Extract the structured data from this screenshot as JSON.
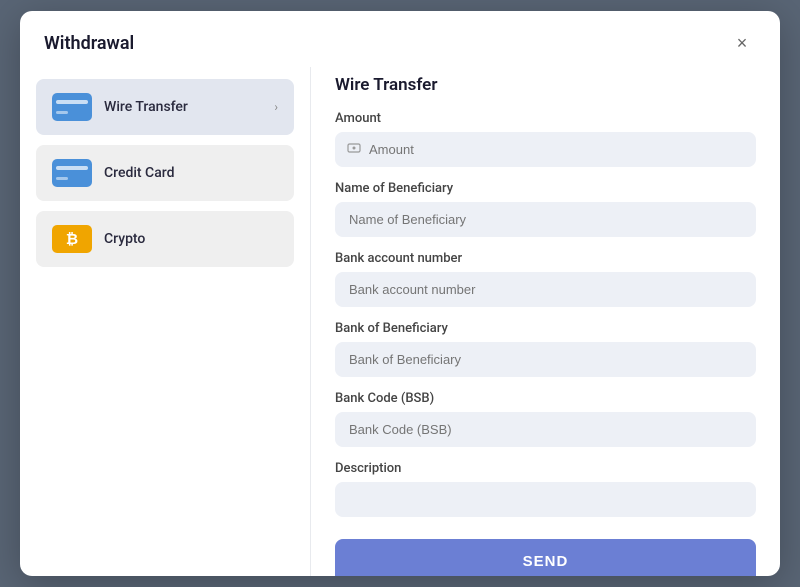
{
  "modal": {
    "title": "Withdrawal",
    "close_label": "×"
  },
  "sidebar": {
    "methods": [
      {
        "id": "wire-transfer",
        "label": "Wire Transfer",
        "icon_type": "bank-card",
        "active": true,
        "has_arrow": true
      },
      {
        "id": "credit-card",
        "label": "Credit Card",
        "icon_type": "bank-card",
        "active": false,
        "has_arrow": false
      },
      {
        "id": "crypto",
        "label": "Crypto",
        "icon_type": "crypto",
        "active": false,
        "has_arrow": false
      }
    ]
  },
  "form": {
    "title": "Wire Transfer",
    "fields": [
      {
        "id": "amount",
        "label": "Amount",
        "placeholder": "Amount",
        "has_icon": true
      },
      {
        "id": "beneficiary-name",
        "label": "Name of Beneficiary",
        "placeholder": "Name of Beneficiary",
        "has_icon": false
      },
      {
        "id": "bank-account",
        "label": "Bank account number",
        "placeholder": "Bank account number",
        "has_icon": false
      },
      {
        "id": "bank-beneficiary",
        "label": "Bank of Beneficiary",
        "placeholder": "Bank of Beneficiary",
        "has_icon": false
      },
      {
        "id": "bank-code",
        "label": "Bank Code (BSB)",
        "placeholder": "Bank Code (BSB)",
        "has_icon": false
      },
      {
        "id": "description",
        "label": "Description",
        "placeholder": "",
        "has_icon": false
      }
    ],
    "submit_label": "SEND"
  }
}
